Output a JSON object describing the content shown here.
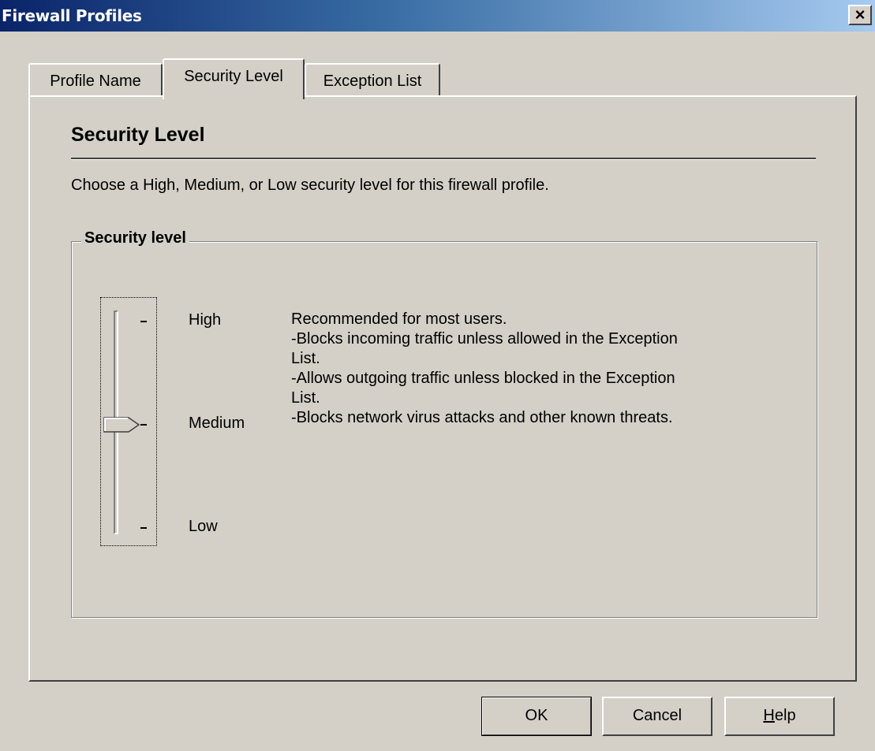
{
  "window": {
    "title": "Firewall Profiles",
    "close_glyph": "×"
  },
  "tabs": [
    {
      "label": "Profile Name",
      "active": false
    },
    {
      "label": "Security Level",
      "active": true
    },
    {
      "label": "Exception List",
      "active": false
    }
  ],
  "security_tab": {
    "heading": "Security Level",
    "description": "Choose a High, Medium, or Low security level for this firewall profile.",
    "group_label": "Security level",
    "slider": {
      "levels": [
        "High",
        "Medium",
        "Low"
      ],
      "selected": "Medium",
      "tick_glyph": "-"
    },
    "level_description": [
      "Recommended for most users.",
      "-Blocks incoming traffic unless allowed in the Exception",
      "List.",
      "-Allows outgoing traffic unless blocked in the Exception",
      "List.",
      "-Blocks network virus attacks and other known threats."
    ]
  },
  "buttons": {
    "ok": "OK",
    "cancel": "Cancel",
    "help_mnemonic": "H",
    "help_rest": "elp"
  },
  "colors": {
    "window_bg": "#d4d0c8",
    "titlebar_start": "#0a246a",
    "titlebar_end": "#a6caf0"
  },
  "icons": {
    "close": "close-icon"
  }
}
